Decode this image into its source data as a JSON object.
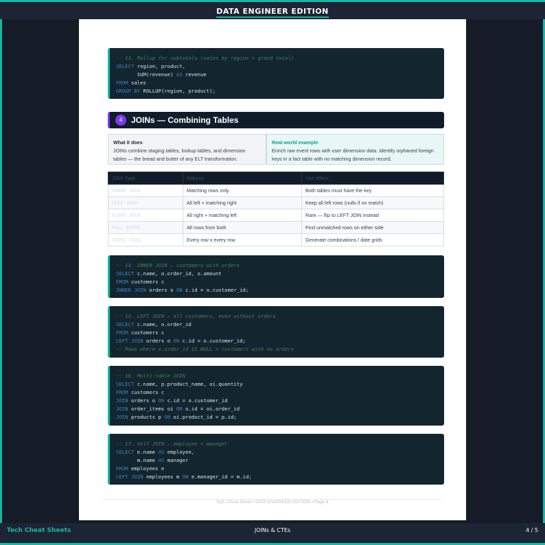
{
  "header": {
    "title": "DATA ENGINEER EDITION"
  },
  "code_blocks": [
    {
      "lines": [
        [
          {
            "t": "-- 13. Rollup for subtotals (sales by region + grand total)",
            "c": "cm"
          }
        ],
        [
          {
            "t": "SELECT",
            "c": "kw"
          },
          {
            "t": " region, product,"
          }
        ],
        [
          {
            "t": "       SUM(revenue) "
          },
          {
            "t": "AS",
            "c": "kw"
          },
          {
            "t": " revenue"
          }
        ],
        [
          {
            "t": "FROM",
            "c": "kw"
          },
          {
            "t": " sales"
          }
        ],
        [
          {
            "t": "GROUP BY",
            "c": "kw"
          },
          {
            "t": " ROLLUP(region, product);"
          }
        ]
      ]
    },
    {
      "lines": [
        [
          {
            "t": "-- 14. INNER JOIN — customers with orders",
            "c": "cm"
          }
        ],
        [
          {
            "t": "SELECT",
            "c": "kw"
          },
          {
            "t": " c.name, o.order_id, o.amount"
          }
        ],
        [
          {
            "t": "FROM",
            "c": "kw"
          },
          {
            "t": " customers c"
          }
        ],
        [
          {
            "t": "INNER JOIN",
            "c": "kw"
          },
          {
            "t": " orders o "
          },
          {
            "t": "ON",
            "c": "kw"
          },
          {
            "t": " c.id = o.customer_id;"
          }
        ]
      ]
    },
    {
      "lines": [
        [
          {
            "t": "-- 15. LEFT JOIN — all customers, even without orders",
            "c": "cm"
          }
        ],
        [
          {
            "t": "SELECT",
            "c": "kw"
          },
          {
            "t": " c.name, o.order_id"
          }
        ],
        [
          {
            "t": "FROM",
            "c": "kw"
          },
          {
            "t": " customers c"
          }
        ],
        [
          {
            "t": "LEFT JOIN",
            "c": "kw"
          },
          {
            "t": " orders o "
          },
          {
            "t": "ON",
            "c": "kw"
          },
          {
            "t": " c.id = o.customer_id;"
          }
        ],
        [
          {
            "t": "-- Rows where o.order_id IS NULL = customers with no orders",
            "c": "cm"
          }
        ]
      ]
    },
    {
      "lines": [
        [
          {
            "t": "-- 16. Multi-table JOIN",
            "c": "cm"
          }
        ],
        [
          {
            "t": "SELECT",
            "c": "kw"
          },
          {
            "t": " c.name, p.product_name, oi.quantity"
          }
        ],
        [
          {
            "t": "FROM",
            "c": "kw"
          },
          {
            "t": " customers c"
          }
        ],
        [
          {
            "t": "JOIN",
            "c": "kw"
          },
          {
            "t": " orders o "
          },
          {
            "t": "ON",
            "c": "kw"
          },
          {
            "t": " c.id = o.customer_id"
          }
        ],
        [
          {
            "t": "JOIN",
            "c": "kw"
          },
          {
            "t": " order_items oi "
          },
          {
            "t": "ON",
            "c": "kw"
          },
          {
            "t": " o.id = oi.order_id"
          }
        ],
        [
          {
            "t": "JOIN",
            "c": "kw"
          },
          {
            "t": " products p "
          },
          {
            "t": "ON",
            "c": "kw"
          },
          {
            "t": " oi.product_id = p.id;"
          }
        ]
      ]
    },
    {
      "lines": [
        [
          {
            "t": "-- 17. Self JOIN — employee + manager",
            "c": "cm"
          }
        ],
        [
          {
            "t": "SELECT",
            "c": "kw"
          },
          {
            "t": " e.name "
          },
          {
            "t": "AS",
            "c": "kw"
          },
          {
            "t": " employee,"
          }
        ],
        [
          {
            "t": "       m.name "
          },
          {
            "t": "AS",
            "c": "kw"
          },
          {
            "t": " manager"
          }
        ],
        [
          {
            "t": "FROM",
            "c": "kw"
          },
          {
            "t": " employees e"
          }
        ],
        [
          {
            "t": "LEFT JOIN",
            "c": "kw"
          },
          {
            "t": " employees m "
          },
          {
            "t": "ON",
            "c": "kw"
          },
          {
            "t": " e.manager_id = m.id;"
          }
        ]
      ]
    }
  ],
  "section": {
    "number": "4",
    "title": "JOINs — Combining Tables"
  },
  "what_it_does": {
    "heading": "What it does",
    "line1": "JOINs combine staging tables, lookup tables, and dimension",
    "line2": "tables — the bread and butter of any ELT transformation."
  },
  "real_world": {
    "heading": "Real-world example",
    "line1": "Enrich raw event rows with user dimension data. Identify orphaned foreign",
    "line2": "keys in a fact table with no matching dimension record."
  },
  "join_table": {
    "headers": [
      "JOIN Type",
      "Returns",
      "Use When"
    ],
    "rows": [
      [
        "INNER JOIN",
        "Matching rows only",
        "Both tables must have the key"
      ],
      [
        "LEFT JOIN",
        "All left + matching right",
        "Keep all left rows (nulls if no match)"
      ],
      [
        "RIGHT JOIN",
        "All right + matching left",
        "Rare — flip to LEFT JOIN instead"
      ],
      [
        "FULL OUTER",
        "All rows from both",
        "Find unmatched rows on either side"
      ],
      [
        "CROSS JOIN",
        "Every row x every row",
        "Generate combinations / date grids"
      ]
    ]
  },
  "page_footer": "SQL Cheat Sheet  •  DATA ENGINEER EDITION  •  Page 4",
  "bottom_bar": {
    "brand": "Tech Cheat Sheets",
    "section": "JOINs & CTEs",
    "page": "4 / 5"
  },
  "colors": {
    "accent": "#14b8a6",
    "section_accent": "#7c3aed",
    "code_bg": "#13262f"
  }
}
